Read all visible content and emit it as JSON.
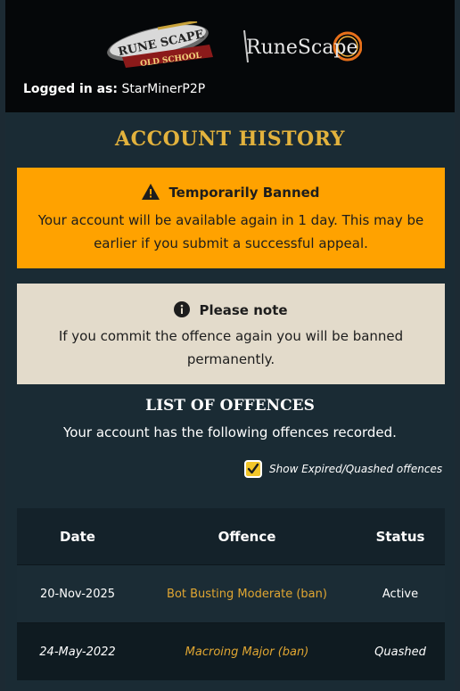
{
  "header": {
    "logo_left_alt": "RuneScape Old School",
    "logo_right_alt": "RuneScape",
    "logged_in_label": "Logged in as:",
    "username": "StarMinerP2P"
  },
  "page_title": "ACCOUNT HISTORY",
  "ban_notice": {
    "title": "Temporarily Banned",
    "message": "Your account will be available again in 1 day. This may be earlier if you submit a successful appeal.",
    "color": "#ffa200"
  },
  "note": {
    "title": "Please note",
    "message": "If you commit the offence again you will be banned permanently.",
    "color": "#e3dbcb"
  },
  "offences": {
    "title": "LIST OF OFFENCES",
    "summary": "Your account has the following offences recorded.",
    "toggle_label": "Show Expired/Quashed offences",
    "toggle_checked": true,
    "columns": [
      "Date",
      "Offence",
      "Status"
    ],
    "rows": [
      {
        "date": "20-Nov-2025",
        "offence": "Bot Busting Moderate (ban)",
        "status": "Active"
      },
      {
        "date": "24-May-2022",
        "offence": "Macroing Major (ban)",
        "status": "Quashed"
      }
    ]
  }
}
